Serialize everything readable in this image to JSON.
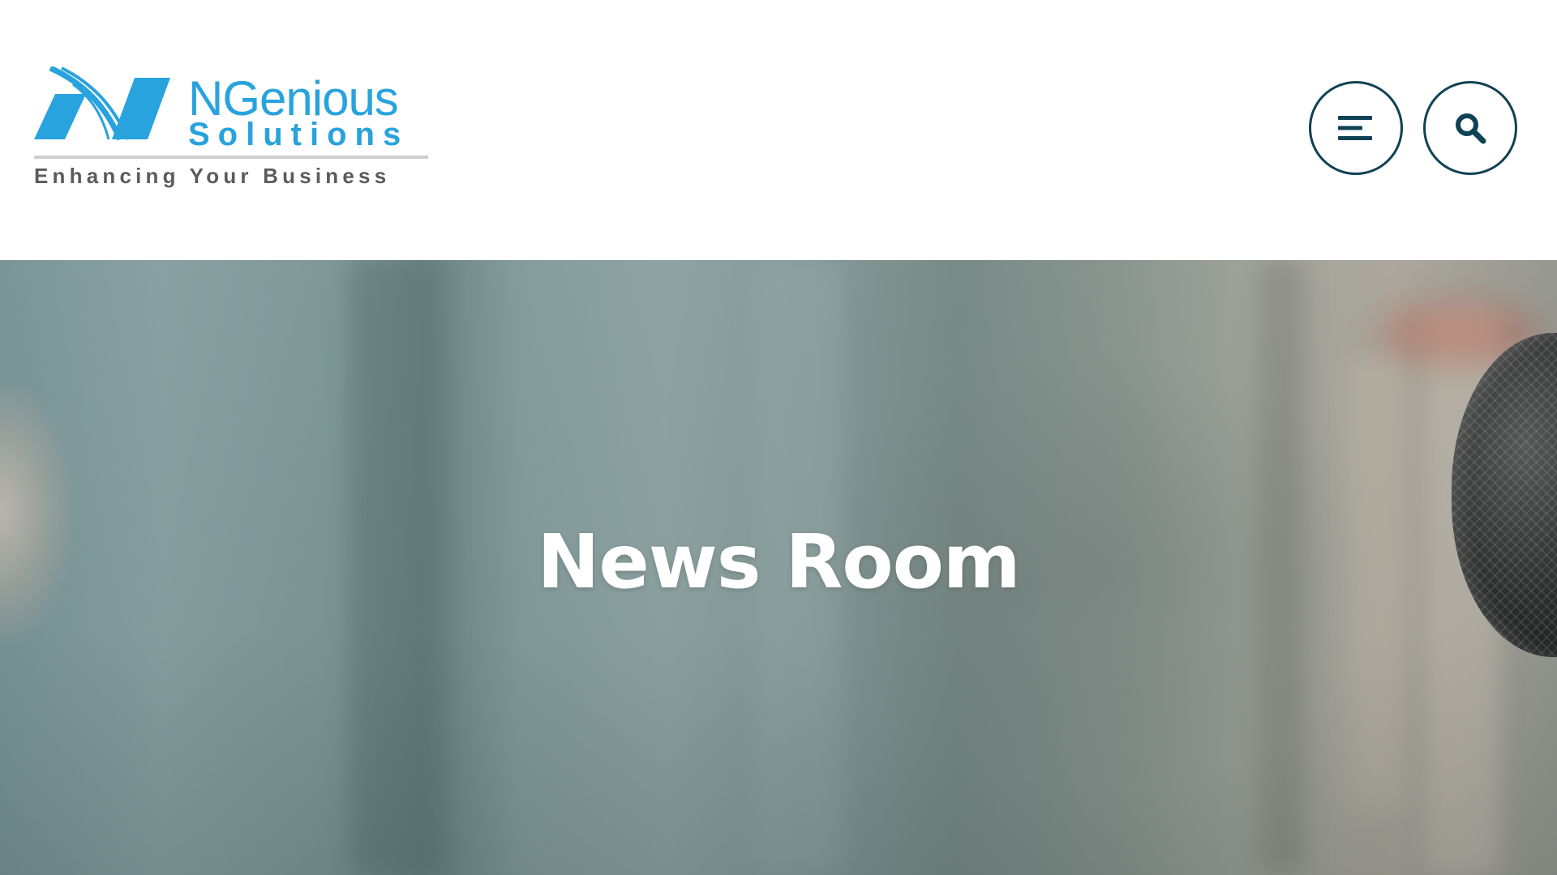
{
  "header": {
    "logo": {
      "brand": "NGenious",
      "sub": "Solutions",
      "tagline": "Enhancing Your Business",
      "brand_color": "#29a3dd",
      "tagline_color": "#5b5b5b"
    },
    "menu_button_icon": "hamburger-menu-icon",
    "search_button_icon": "search-icon",
    "button_border_color": "#0f4254"
  },
  "hero": {
    "title": "News Room",
    "background_image": "blurred-newsroom-microphone-photo"
  }
}
